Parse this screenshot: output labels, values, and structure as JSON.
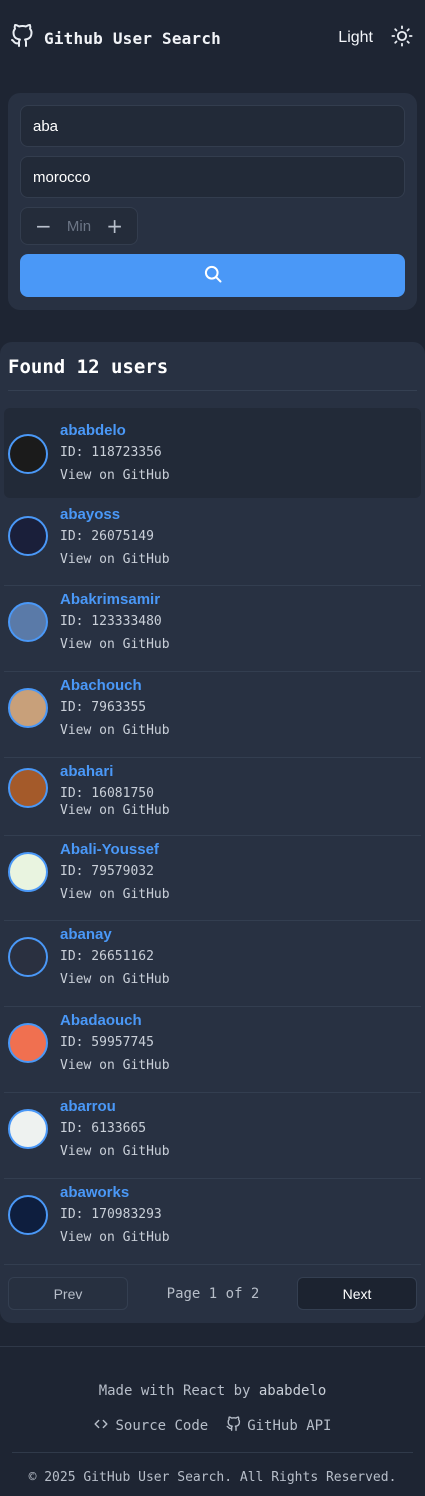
{
  "header": {
    "title": "Github User Search",
    "theme_label": "Light"
  },
  "search": {
    "username_value": "aba",
    "location_value": "morocco",
    "min_placeholder": "Min",
    "stepper_minus": "−",
    "stepper_plus": "+"
  },
  "results": {
    "heading": "Found 12 users",
    "users": [
      {
        "login": "ababdelo",
        "id": "ID: 118723356",
        "link": "View on GitHub",
        "avatar_bg": "#1b1b1b"
      },
      {
        "login": "abayoss",
        "id": "ID: 26075149",
        "link": "View on GitHub",
        "avatar_bg": "#1a1f3a"
      },
      {
        "login": "Abakrimsamir",
        "id": "ID: 123333480",
        "link": "View on GitHub",
        "avatar_bg": "#5a7aa8"
      },
      {
        "login": "Abachouch",
        "id": "ID: 7963355",
        "link": "View on GitHub",
        "avatar_bg": "#c8a07a"
      },
      {
        "login": "abahari",
        "id": "ID: 16081750",
        "link": "View on GitHub",
        "avatar_bg": "#a45a2a"
      },
      {
        "login": "Abali-Youssef",
        "id": "ID: 79579032",
        "link": "View on GitHub",
        "avatar_bg": "#e9f4e0"
      },
      {
        "login": "abanay",
        "id": "ID: 26651162",
        "link": "View on GitHub",
        "avatar_bg": "#2a3040"
      },
      {
        "login": "Abadaouch",
        "id": "ID: 59957745",
        "link": "View on GitHub",
        "avatar_bg": "#f07050"
      },
      {
        "login": "abarrou",
        "id": "ID: 6133665",
        "link": "View on GitHub",
        "avatar_bg": "#eef2f0"
      },
      {
        "login": "abaworks",
        "id": "ID: 170983293",
        "link": "View on GitHub",
        "avatar_bg": "#0e1e3e"
      }
    ]
  },
  "pagination": {
    "prev": "Prev",
    "next": "Next",
    "page_info": "Page 1 of 2"
  },
  "footer": {
    "made_with": "Made with React by",
    "author": "ababdelo",
    "source_code": "Source Code",
    "github_api": "GitHub API",
    "copyright": "© 2025 GitHub User Search. All Rights Reserved."
  },
  "colors": {
    "accent": "#4a98f7",
    "background": "#1e2533",
    "card": "#283142"
  }
}
